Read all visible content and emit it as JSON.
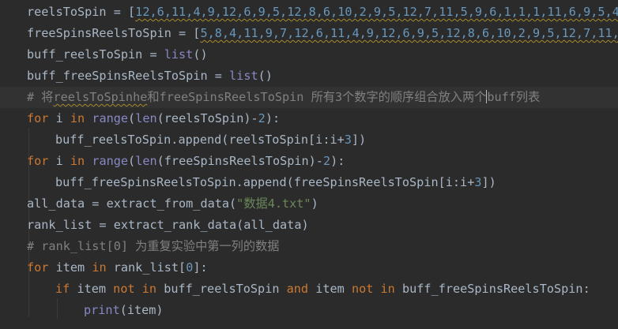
{
  "lines": [
    {
      "t1": "reelsToSpin",
      "t2": " = [",
      "t3": "12,6,11,4,9,12,6,9,5,12,8,6,10,2,9,5,12,7,11,5,9,6,1,1,1,11,6,9,5,4,"
    },
    {
      "t1": "freeSpinsReelsToSpin",
      "t2": " = [",
      "t3": "5,8,4,11,9,7,12,6,11,4,9,12,6,9,5,12,8,6,10,2,9,5,12,7,11,5"
    },
    {
      "t1": "buff_reelsToSpin = ",
      "t2": "list",
      "t3": "()"
    },
    {
      "t1": "buff_freeSpinsReelsToSpin = ",
      "t2": "list",
      "t3": "()"
    },
    {
      "t1": "# 将",
      "t2": "reelsToSpinhe",
      "t3": "和freeSpinsReelsToSpin 所有3个数字的顺序组合放入两个",
      "t4": "buff列表"
    },
    {
      "t1": "for",
      "t2": " i ",
      "t3": "in",
      "t4": " ",
      "t5": "range",
      "t6": "(",
      "t7": "len",
      "t8": "(reelsToSpin)-",
      "t9": "2",
      "t10": "):"
    },
    {
      "t1": "buff_reelsToSpin.append(reelsToSpin[i:i+",
      "t2": "3",
      "t3": "])"
    },
    {
      "t1": "for",
      "t2": " i ",
      "t3": "in",
      "t4": " ",
      "t5": "range",
      "t6": "(",
      "t7": "len",
      "t8": "(freeSpinsReelsToSpin)-",
      "t9": "2",
      "t10": "):"
    },
    {
      "t1": "buff_freeSpinsReelsToSpin.append(freeSpinsReelsToSpin[i:i+",
      "t2": "3",
      "t3": "])"
    },
    {
      "t1": "all_data = extract_from_data(",
      "t2": "\"数据4.txt\"",
      "t3": ")"
    },
    {
      "t1": "rank_list = extract_rank_data(all_data)"
    },
    {
      "t1": "# rank_list[0] 为重复实验中第一列的数据"
    },
    {
      "t1": "for",
      "t2": " item ",
      "t3": "in",
      "t4": " rank_list[",
      "t5": "0",
      "t6": "]:"
    },
    {
      "t1": "if",
      "t2": " item ",
      "t3": "not in",
      "t4": " buff_reelsToSpin ",
      "t5": "and",
      "t6": " item ",
      "t7": "not in",
      "t8": " buff_freeSpinsReelsToSpin:"
    },
    {
      "t1": "print",
      "t2": "(item)"
    }
  ],
  "colors": {
    "background": "#2b2b2b",
    "default_text": "#a9b7c6",
    "keyword": "#cc7832",
    "builtin": "#8888c6",
    "number": "#6897bb",
    "string": "#6a8759",
    "comment": "#808080",
    "current_line": "#323232"
  }
}
